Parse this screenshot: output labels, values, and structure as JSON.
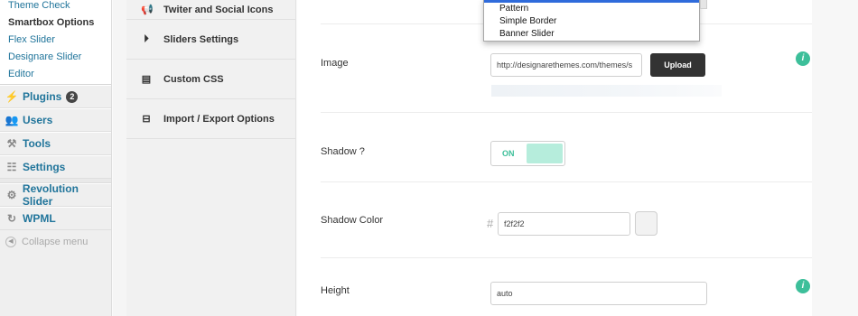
{
  "sidebar": {
    "submenu": [
      "Theme Check",
      "Smartbox Options",
      "Flex Slider",
      "Designare Slider",
      "Editor"
    ],
    "plugins": {
      "label": "Plugins",
      "badge": "2"
    },
    "users": "Users",
    "tools": "Tools",
    "settings": "Settings",
    "revolution_slider": "Revolution Slider",
    "wpml": "WPML",
    "collapse": "Collapse menu"
  },
  "options_nav": {
    "items": [
      {
        "label": "Twiter and Social Icons",
        "icon": "megaphone-icon"
      },
      {
        "label": "Sliders Settings",
        "icon": "play-circle-icon"
      },
      {
        "label": "Custom CSS",
        "icon": "document-icon"
      },
      {
        "label": "Import / Export Options",
        "icon": "drive-icon"
      }
    ]
  },
  "dropdown": {
    "options": [
      "Pattern",
      "Simple Border",
      "Banner Slider"
    ]
  },
  "fields": {
    "image": {
      "label": "Image",
      "value": "http://designarethemes.com/themes/s",
      "button": "Upload"
    },
    "shadow": {
      "label": "Shadow ?",
      "toggle": "ON"
    },
    "shadow_color": {
      "label": "Shadow Color",
      "hash": "#",
      "value": "f2f2f2",
      "swatch": "#f2f2f2"
    },
    "height": {
      "label": "Height",
      "value": "auto"
    }
  },
  "colors": {
    "accent": "#3dbf9a",
    "link": "#21759b",
    "selection": "#2f6bdb"
  }
}
